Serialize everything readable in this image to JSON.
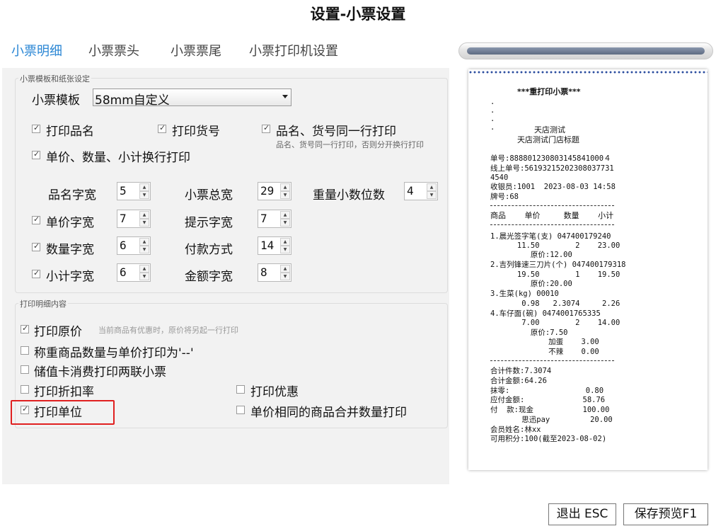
{
  "title": "设置-小票设置",
  "tabs": [
    {
      "label": "小票明细",
      "active": true
    },
    {
      "label": "小票票头",
      "active": false
    },
    {
      "label": "小票票尾",
      "active": false
    },
    {
      "label": "小票打印机设置",
      "active": false
    }
  ],
  "template_group": {
    "legend": "小票模板和纸张设定",
    "template_label": "小票模板",
    "template_value": "58mm自定义",
    "print_name": {
      "label": "打印品名",
      "checked": true
    },
    "print_code": {
      "label": "打印货号",
      "checked": true
    },
    "same_line": {
      "label": "品名、货号同一行打印",
      "checked": true,
      "note": "品名、货号同一行打印，否则分开换行打印"
    },
    "wrap_lines": {
      "label": "单价、数量、小计换行打印",
      "checked": true
    },
    "name_width": {
      "label": "品名字宽",
      "value": "5"
    },
    "total_width": {
      "label": "小票总宽",
      "value": "29"
    },
    "weight_decimals": {
      "label": "重量小数位数",
      "value": "4"
    },
    "price_width": {
      "label": "单价字宽",
      "value": "7",
      "checked": true
    },
    "hint_width": {
      "label": "提示字宽",
      "value": "7"
    },
    "qty_width": {
      "label": "数量字宽",
      "value": "6",
      "checked": true
    },
    "payment_method": {
      "label": "付款方式",
      "value": "14"
    },
    "subtotal_width": {
      "label": "小计字宽",
      "value": "6",
      "checked": true
    },
    "amount_width": {
      "label": "金额字宽",
      "value": "8"
    }
  },
  "detail_group": {
    "legend": "打印明细内容",
    "original_price": {
      "label": "打印原价",
      "checked": true,
      "note": "当前商品有优惠时，原价将另起一行打印"
    },
    "weighed_dash": {
      "label": "称重商品数量与单价打印为'--'",
      "checked": false
    },
    "stored_card": {
      "label": "储值卡消费打印两联小票",
      "checked": false
    },
    "discount_rate": {
      "label": "打印折扣率",
      "checked": false
    },
    "print_discount": {
      "label": "打印优惠",
      "checked": false
    },
    "print_unit": {
      "label": "打印单位",
      "checked": true
    },
    "merge_same_price": {
      "label": "单价相同的商品合并数量打印",
      "checked": false
    }
  },
  "receipt": {
    "title": "***重打印小票***",
    "dots": ".",
    "shop": "天店测试",
    "shop_title": "天店测试门店标题",
    "order_no": "单号:888801230803145841000４",
    "online_no_1": "线上单号:56193215202308037731",
    "online_no_2": "4540",
    "cashier": "收银员:1001  2023-08-03 14:58",
    "tag": "牌号:68",
    "header": "商品    单价     数量    小计",
    "item1_name": "1.晨光签字笔(支) 047400179240",
    "item1_vals": "      11.50        2    23.00",
    "item1_orig": "         原价:12.00",
    "item2_name": "2.吉列锋速三刀片(个) 047400179318",
    "item2_vals": "      19.50        1    19.50",
    "item2_orig": "         原价:20.00",
    "item3_name": "3.生菜(kg) 00010",
    "item3_vals": "       0.98   2.3074     2.26",
    "item4_name": "4.车仔面(碗) 0474001765335",
    "item4_vals": "       7.00        2    14.00",
    "item4_orig": "         原价:7.50",
    "addon1": "             加蛋    3.00",
    "addon2": "             不辣    0.00",
    "total_count": "合计件数:7.3074",
    "total_amount": "合计金额:64.26",
    "rounding": "抹零:                 0.80",
    "payable": "应付金额:             58.76",
    "paid": "付  款:现金           100.00",
    "paid2": "       思迅pay         20.00",
    "member": "会员姓名:林xx",
    "points": "可用积分:100(截至2023-08-02)"
  },
  "buttons": {
    "exit": "退出 ESC",
    "save": "保存预览F1"
  }
}
